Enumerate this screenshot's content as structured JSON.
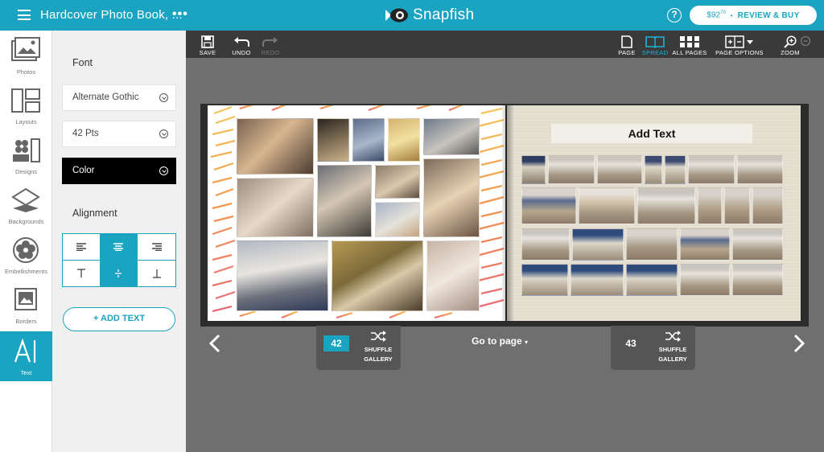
{
  "header": {
    "menu_icon": "hamburger-menu-icon",
    "title": "Hardcover Photo Book, ...",
    "more_icon": "more-dots-icon",
    "brand": "Snapfish",
    "help_icon": "help-icon",
    "price_main": "$92",
    "price_cents": "70",
    "buy_label": "REVIEW & BUY",
    "accent_color": "#1aa4c1"
  },
  "rail": {
    "items": [
      {
        "label": "Photos",
        "icon": "photos-icon"
      },
      {
        "label": "Layouts",
        "icon": "layouts-icon"
      },
      {
        "label": "Designs",
        "icon": "designs-icon"
      },
      {
        "label": "Backgrounds",
        "icon": "backgrounds-icon"
      },
      {
        "label": "Embellishments",
        "icon": "embellishments-icon"
      },
      {
        "label": "Borders",
        "icon": "borders-icon"
      },
      {
        "label": "Text",
        "icon": "text-icon",
        "active": true
      }
    ]
  },
  "panel": {
    "font_heading": "Font",
    "font_value": "Alternate Gothic",
    "size_value": "42 Pts",
    "color_value": "Color",
    "alignment_heading": "Alignment",
    "add_text_label": "ADD TEXT",
    "add_text_prefix": "+",
    "alignment_selected": [
      "center",
      "middle"
    ]
  },
  "toolbar": {
    "save": "SAVE",
    "undo": "UNDO",
    "redo": "REDO",
    "page": "PAGE",
    "spread": "SPREAD",
    "all_pages": "ALL PAGES",
    "page_options": "PAGE OPTIONS",
    "zoom": "ZOOM",
    "active_view": "SPREAD"
  },
  "spread": {
    "right_text": "Add Text",
    "left_page_photos": 14,
    "right_page_photos": 28
  },
  "navigation": {
    "left_page_number": "42",
    "right_page_number": "43",
    "shuffle_line1": "SHUFFLE",
    "shuffle_line2": "GALLERY",
    "goto_label": "Go to page",
    "prev_icon": "chevron-left-icon",
    "next_icon": "chevron-right-icon"
  }
}
